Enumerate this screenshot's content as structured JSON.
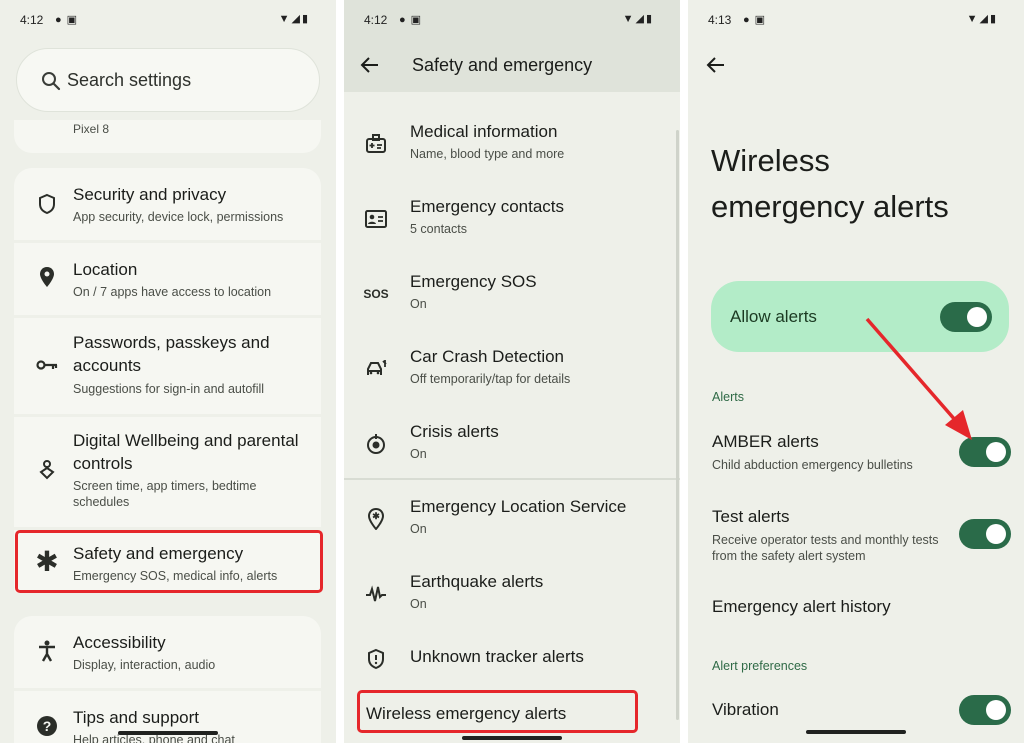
{
  "panel1": {
    "status": {
      "time": "4:12"
    },
    "search": {
      "placeholder": "Search settings"
    },
    "partial_item": "Pixel 8",
    "items": [
      {
        "title": "Security and privacy",
        "subtitle": "App security, device lock, permissions",
        "icon": "shield-icon"
      },
      {
        "title": "Location",
        "subtitle": "On / 7 apps have access to location",
        "icon": "location-pin-icon"
      },
      {
        "title": "Passwords, passkeys and accounts",
        "subtitle": "Suggestions for sign-in and autofill",
        "icon": "key-icon"
      },
      {
        "title": "Digital Wellbeing and parental controls",
        "subtitle": "Screen time, app timers, bedtime schedules",
        "icon": "wellbeing-icon"
      },
      {
        "title": "Safety and emergency",
        "subtitle": "Emergency SOS, medical info, alerts",
        "icon": "asterisk-icon"
      },
      {
        "title": "Accessibility",
        "subtitle": "Display, interaction, audio",
        "icon": "accessibility-icon"
      },
      {
        "title": "Tips and support",
        "subtitle": "Help articles, phone and chat",
        "icon": "help-icon"
      }
    ]
  },
  "panel2": {
    "status": {
      "time": "4:12"
    },
    "title": "Safety and emergency",
    "items": [
      {
        "title": "Medical information",
        "subtitle": "Name, blood type and more",
        "icon": "medical-id-icon"
      },
      {
        "title": "Emergency contacts",
        "subtitle": "5 contacts",
        "icon": "contact-card-icon"
      },
      {
        "title": "Emergency SOS",
        "subtitle": "On",
        "icon": "sos-icon",
        "icon_text": "SOS"
      },
      {
        "title": "Car Crash Detection",
        "subtitle": "Off temporarily/tap for details",
        "icon": "car-crash-icon"
      },
      {
        "title": "Crisis alerts",
        "subtitle": "On",
        "icon": "crisis-icon"
      },
      {
        "title": "Emergency Location Service",
        "subtitle": "On",
        "icon": "location-service-icon"
      },
      {
        "title": "Earthquake alerts",
        "subtitle": "On",
        "icon": "seismograph-icon"
      },
      {
        "title": "Unknown tracker alerts",
        "subtitle": "",
        "icon": "tracker-shield-icon"
      },
      {
        "title": "Wireless emergency alerts",
        "subtitle": "",
        "icon": ""
      }
    ]
  },
  "panel3": {
    "status": {
      "time": "4:13"
    },
    "title_line1": "Wireless",
    "title_line2": "emergency alerts",
    "allow": {
      "label": "Allow alerts",
      "on": true
    },
    "section_alerts": "Alerts",
    "amber": {
      "title": "AMBER alerts",
      "subtitle": "Child abduction emergency bulletins",
      "on": true
    },
    "test": {
      "title": "Test alerts",
      "subtitle": "Receive operator tests and monthly tests from the safety alert system",
      "on": true
    },
    "history": {
      "title": "Emergency alert history"
    },
    "section_prefs": "Alert preferences",
    "vibration": {
      "title": "Vibration",
      "on": true
    }
  },
  "colors": {
    "background": "#eef0e9",
    "card": "#f6f7f2",
    "header": "#dfe3da",
    "allow_bg": "#b3ecc8",
    "toggle_on": "#2a6b49",
    "section_text": "#2f6a46",
    "highlight": "#e5272b"
  }
}
